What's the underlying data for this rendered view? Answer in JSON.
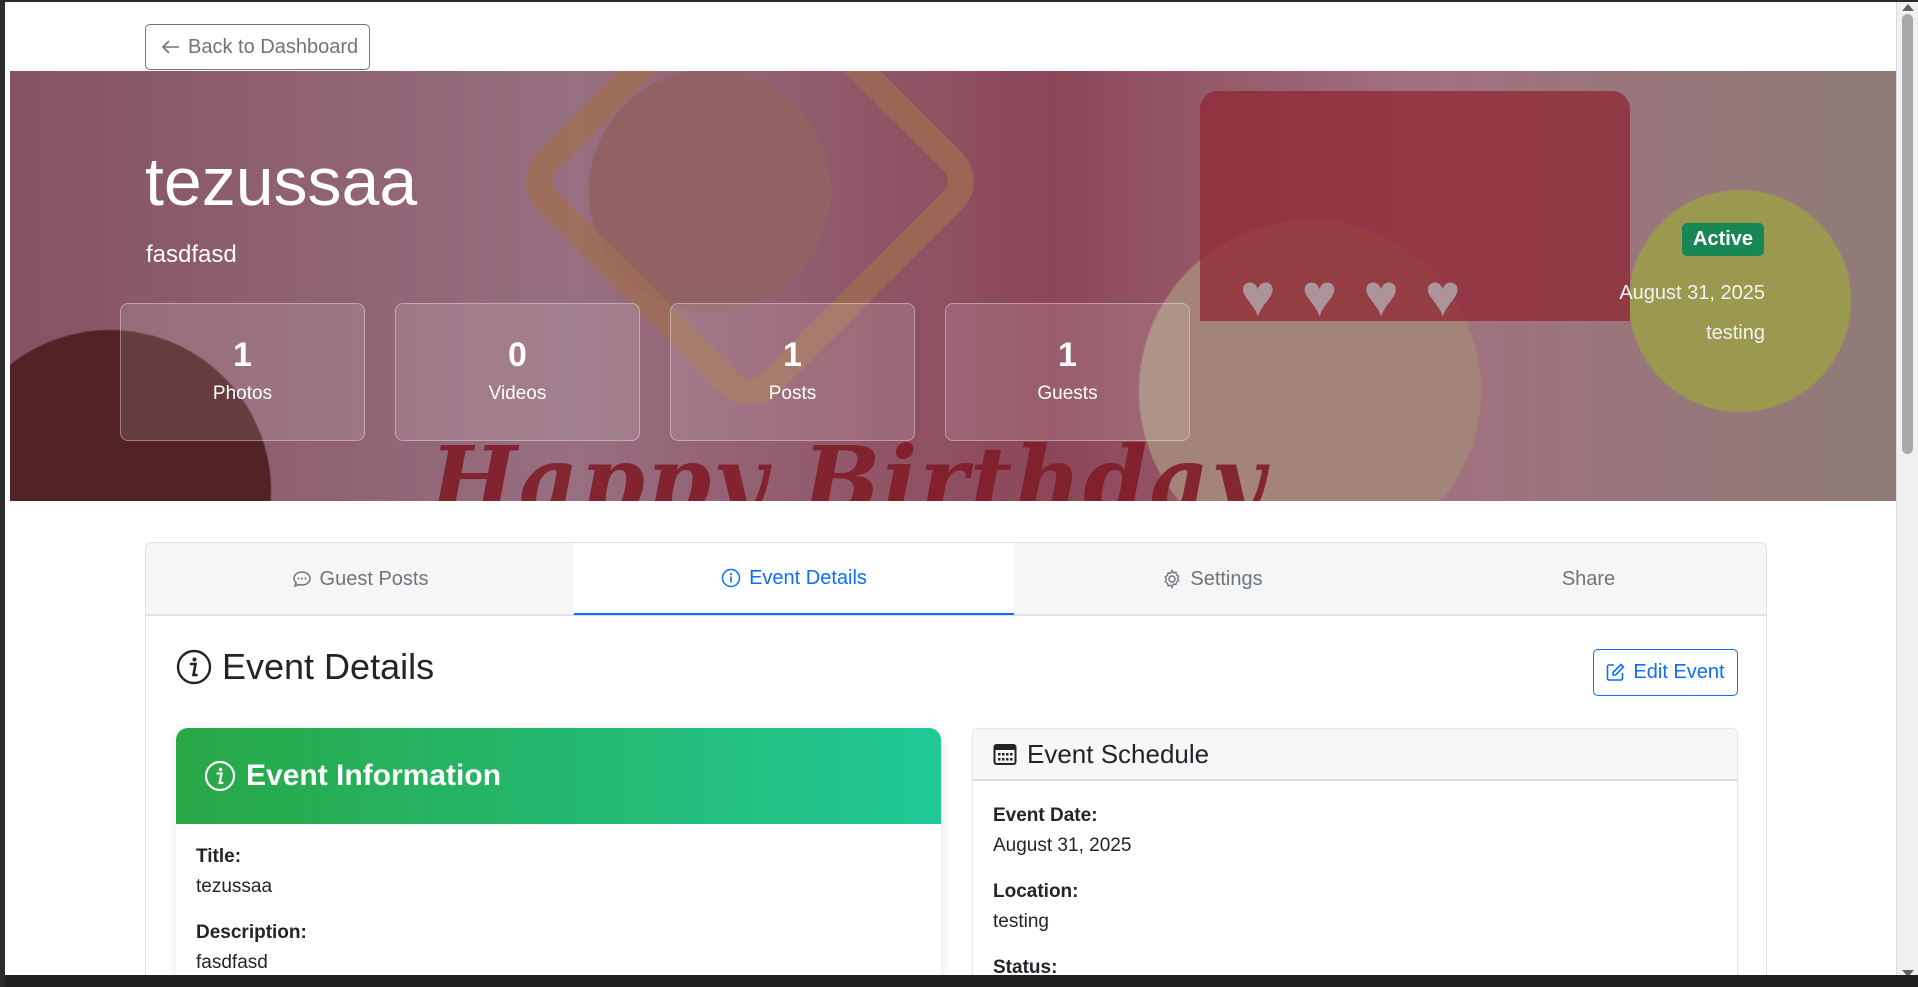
{
  "nav": {
    "back_label": "Back to Dashboard"
  },
  "event": {
    "title": "tezussaa",
    "subtitle": "fasdfasd",
    "status": "Active",
    "date": "August 31, 2025",
    "location": "testing"
  },
  "hero": {
    "banner_text": "Happy Birthday"
  },
  "stats": [
    {
      "value": "1",
      "label": "Photos"
    },
    {
      "value": "0",
      "label": "Videos"
    },
    {
      "value": "1",
      "label": "Posts"
    },
    {
      "value": "1",
      "label": "Guests"
    }
  ],
  "tabs": [
    {
      "label": "Guest Posts",
      "icon": "chat-icon"
    },
    {
      "label": "Event Details",
      "icon": "info-icon",
      "active": true
    },
    {
      "label": "Settings",
      "icon": "gear-icon"
    },
    {
      "label": "Share"
    }
  ],
  "section": {
    "title": "Event Details",
    "edit_label": "Edit Event"
  },
  "info_card": {
    "title": "Event Information",
    "fields": [
      {
        "label": "Title:",
        "value": "tezussaa"
      },
      {
        "label": "Description:",
        "value": "fasdfasd"
      }
    ]
  },
  "schedule_card": {
    "title": "Event Schedule",
    "fields": [
      {
        "label": "Event Date:",
        "value": "August 31, 2025"
      },
      {
        "label": "Location:",
        "value": "testing"
      },
      {
        "label": "Status:",
        "value": ""
      }
    ]
  },
  "colors": {
    "primary": "#0d6efd",
    "success": "#198754",
    "gradient_start": "#28a745",
    "gradient_end": "#20c997",
    "muted": "#6c757d"
  }
}
